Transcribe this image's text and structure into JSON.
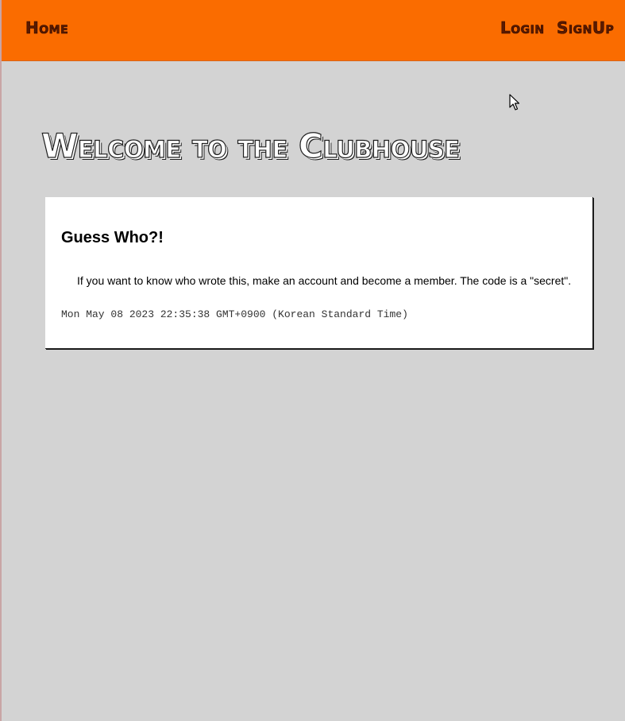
{
  "nav": {
    "home_label": "Home",
    "login_label": "Login",
    "signup_label": "SignUp"
  },
  "hero": {
    "title": "Welcome to the Clubhouse"
  },
  "message_card": {
    "title": "Guess Who?!",
    "text": "If you want to know who wrote this, make an account and become a member. The code is a \"secret\".",
    "timestamp": "Mon May 08 2023 22:35:38 GMT+0900 (Korean Standard Time)"
  },
  "colors": {
    "navbar_bg": "#fa6c00",
    "page_bg": "#d3d3d3",
    "card_bg": "#ffffff"
  },
  "icons": {
    "cursor": "mouse-pointer-icon"
  }
}
